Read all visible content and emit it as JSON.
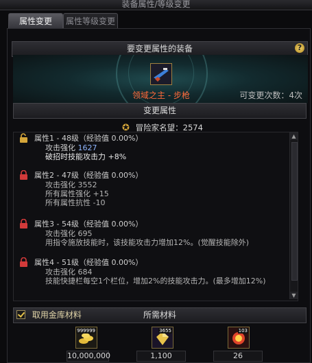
{
  "window": {
    "title": "装备属性/等级变更"
  },
  "tabs": [
    {
      "label": "属性变更",
      "active": true
    },
    {
      "label": "属性等级变更",
      "active": false
    }
  ],
  "equip_section": {
    "header": "要变更属性的装备",
    "help_icon": "question-icon",
    "item_name": "领域之主 - 步枪",
    "change_count": "可变更次数：4次"
  },
  "change_section": {
    "header": "变更属性",
    "fame": "冒险家名望：2574",
    "attributes": [
      {
        "title": "属性1 - 48级（经验值 0.00%）",
        "locked": false,
        "lines": [
          "攻击强化",
          "1627",
          "破招时技能攻击力 +8%"
        ]
      },
      {
        "title": "属性2 - 47级（经验值 0.00%）",
        "locked": true,
        "lines": [
          "攻击强化 3552",
          "所有属性强化 +15",
          "所有属性抗性 -10"
        ]
      },
      {
        "title": "属性3 - 54级（经验值 0.00%）",
        "locked": true,
        "lines": [
          "攻击强化 695",
          "用指令施放技能时，该技能攻击力增加12%。(觉醒技能除外)"
        ]
      },
      {
        "title": "属性4 - 51级（经验值 0.00%）",
        "locked": true,
        "lines": [
          "攻击强化 684",
          "技能快捷栏每空1个栏位，增加2%的技能攻击力。(最多增加12%)"
        ]
      }
    ]
  },
  "materials_section": {
    "checkbox_label": "取用金库材料",
    "checked": true,
    "header": "所需材料",
    "items": [
      {
        "icon": "gold-coins-icon",
        "badge": "999999",
        "value": "10,000,000"
      },
      {
        "icon": "crystal-icon",
        "badge": "3655",
        "value": "1,100"
      },
      {
        "icon": "orb-icon",
        "badge": "103",
        "value": "26"
      }
    ]
  },
  "colors": {
    "item_name": "#ff6a3a",
    "accent_gold": "#d5a63a",
    "value_blue": "#8fb6ff"
  }
}
